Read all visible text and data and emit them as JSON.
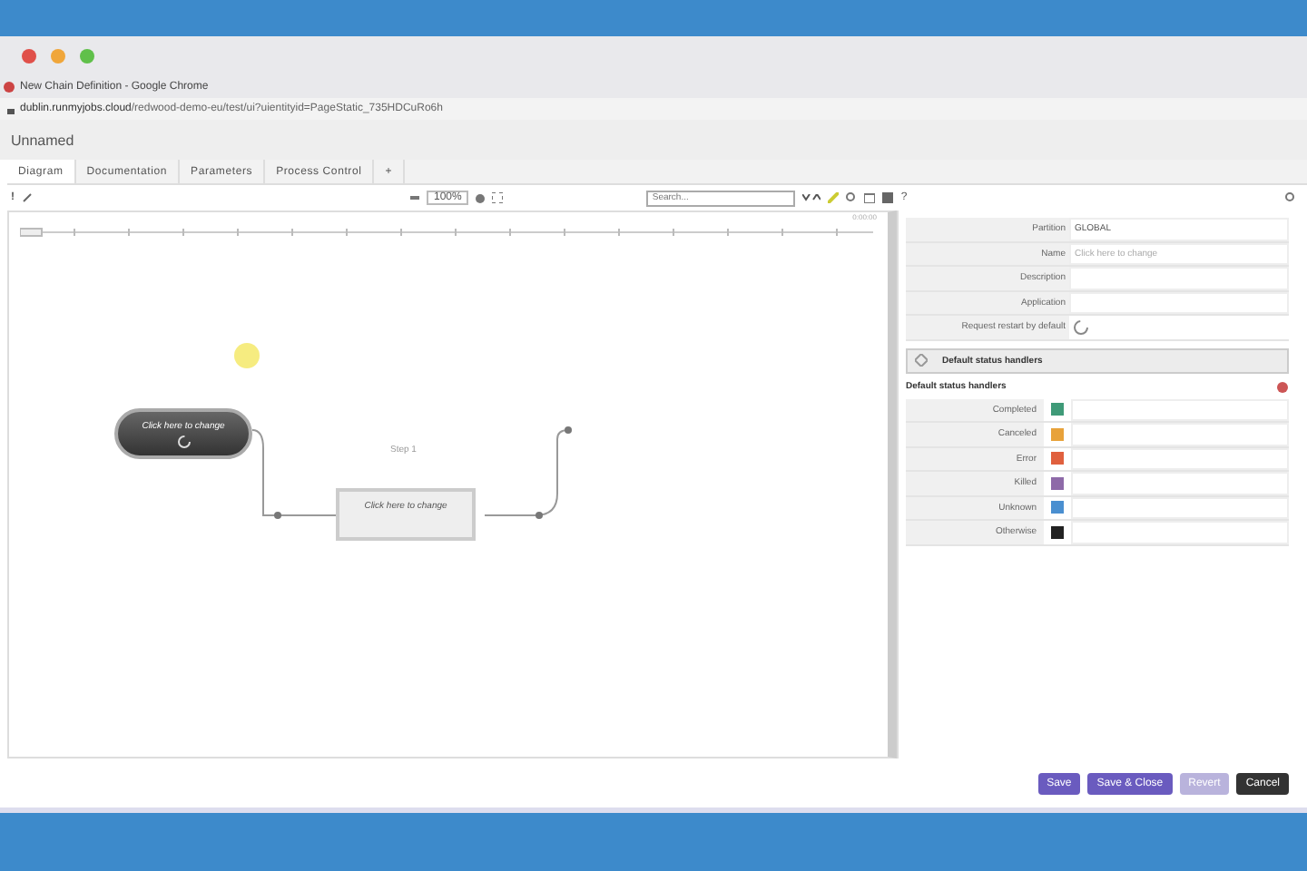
{
  "browser": {
    "tab_title": "New Chain Definition - Google Chrome",
    "url_host": "dublin.runmyjobs.cloud",
    "url_path": "/redwood-demo-eu/test/ui?uientityid=PageStatic_735HDCuRo6h"
  },
  "app": {
    "title": "Unnamed"
  },
  "tabs": [
    {
      "label": "Diagram",
      "selected": true
    },
    {
      "label": "Documentation",
      "selected": false
    },
    {
      "label": "Parameters",
      "selected": false
    },
    {
      "label": "Process Control",
      "selected": false
    },
    {
      "label": "+",
      "selected": false
    }
  ],
  "toolbar": {
    "bang": "!",
    "zoom": "100%",
    "search": {
      "placeholder": "Search..."
    },
    "help": "?"
  },
  "timeline": {
    "time": "0:00:00"
  },
  "diagram": {
    "start_node": "Click here to change",
    "step_title": "Step 1",
    "step_node": "Click here to change"
  },
  "properties": [
    {
      "kind": "text",
      "label": "Partition",
      "value": "GLOBAL"
    },
    {
      "kind": "hint",
      "label": "Name",
      "value": "Click here to change"
    },
    {
      "kind": "text",
      "label": "Description"
    },
    {
      "kind": "text",
      "label": "Application"
    },
    {
      "kind": "toggle",
      "label": "Request restart by default"
    }
  ],
  "section": {
    "title": "Default status handlers",
    "expanded": false
  },
  "handlers_title": "Default status handlers",
  "handlers": [
    {
      "label": "Completed",
      "color": "#3f9a78"
    },
    {
      "label": "Canceled",
      "color": "#e8a23a"
    },
    {
      "label": "Error",
      "color": "#e0603e"
    },
    {
      "label": "Killed",
      "color": "#8e6aa8"
    },
    {
      "label": "Unknown",
      "color": "#4a8fd0"
    },
    {
      "label": "Otherwise",
      "color": "#222222"
    }
  ],
  "buttons": [
    {
      "label": "Save",
      "kind": "primary",
      "disabled": false
    },
    {
      "label": "Save & Close",
      "kind": "primary",
      "disabled": false
    },
    {
      "label": "Revert",
      "kind": "primary",
      "disabled": true
    },
    {
      "label": "Cancel",
      "kind": "dark",
      "disabled": false
    }
  ]
}
